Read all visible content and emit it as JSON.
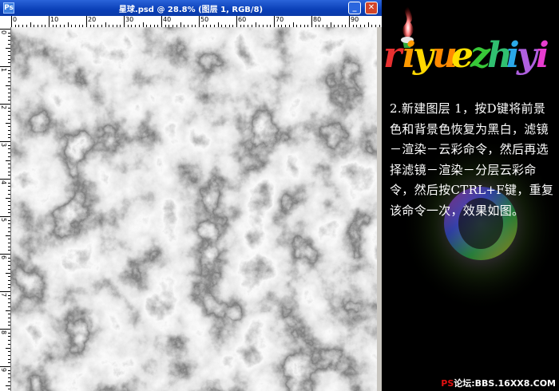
{
  "window": {
    "title": "星球.psd @ 28.8% (图层 1, RGB/8)",
    "minimize_glyph": "_",
    "close_glyph": "✕"
  },
  "ruler": {
    "top_labels": [
      "0",
      "10",
      "20",
      "30",
      "40",
      "50",
      "60",
      "70",
      "80",
      "90"
    ],
    "left_labels": [
      "0",
      "1",
      "2",
      "3",
      "4",
      "5",
      "6",
      "7",
      "8",
      "9"
    ]
  },
  "canvas": {
    "content": "clouds-render-layer"
  },
  "brand": {
    "letters": [
      "r",
      "i",
      "y",
      "u",
      "e",
      "z",
      "h",
      "i",
      "y",
      "i"
    ],
    "colors": [
      "#e83030",
      "#ff9a00",
      "#ffd800",
      "#ff8a00",
      "#ffe000",
      "#38c838",
      "#30c070",
      "#2aa8e8",
      "#b060e0",
      "#e83cd0"
    ]
  },
  "instruction": {
    "text": "2.新建图层 1，按D键将前景色和背景色恢复为黑白，滤镜－渲染－云彩命令，然后再选择滤镜－渲染－分层云彩命令，然后按CTRL+F键，重复该命令一次，效果如图。"
  },
  "footer": {
    "ps": "PS",
    "site": "论坛:BBS.16XX8.COM"
  }
}
